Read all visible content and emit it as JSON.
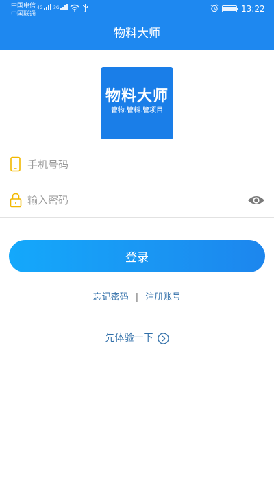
{
  "status_bar": {
    "carrier_1": "中国电信",
    "carrier_2": "中国联通",
    "sig_1_tag": "4G",
    "sig_2_tag": "3G",
    "time": "13:22",
    "battery_level": 1.0,
    "icons": [
      "signal-icon",
      "wifi-icon",
      "usb-icon",
      "alarm-icon",
      "battery-icon"
    ]
  },
  "app": {
    "title": "物料大师"
  },
  "logo": {
    "main": "物料大师",
    "sub": "管物.管料.管项目"
  },
  "login_form": {
    "phone_placeholder": "手机号码",
    "password_placeholder": "输入密码",
    "login_button": "登录"
  },
  "links": {
    "forgot_password": "忘记密码",
    "separator": "|",
    "register": "注册账号",
    "try_first": "先体验一下"
  },
  "colors": {
    "header": "#1e88f0",
    "button_start": "#14a8fb",
    "button_end": "#1c86ee",
    "link": "#2f6ea8",
    "field_icon": "#f2b800"
  }
}
